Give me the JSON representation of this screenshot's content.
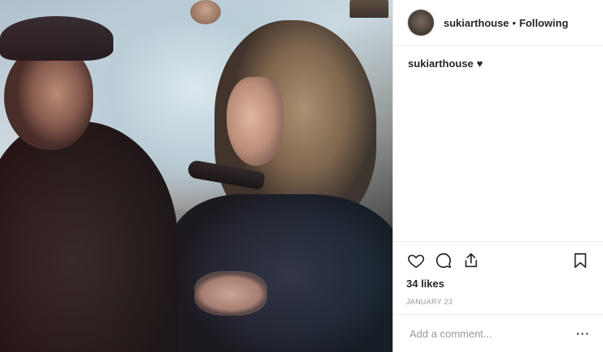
{
  "post": {
    "author": "sukiarthouse",
    "separator": "•",
    "follow_state": "Following",
    "caption_user": "sukiarthouse",
    "caption_text": "♥",
    "likes": "34 likes",
    "date": "JANUARY 23",
    "comment_placeholder": "Add a comment...",
    "more_label": "···"
  },
  "icons": {
    "like": "heart-outline-icon",
    "comment": "comment-bubble-icon",
    "share": "share-upload-icon",
    "save": "bookmark-icon"
  },
  "colors": {
    "text": "#262626",
    "muted": "#999999",
    "border": "#efefef"
  }
}
